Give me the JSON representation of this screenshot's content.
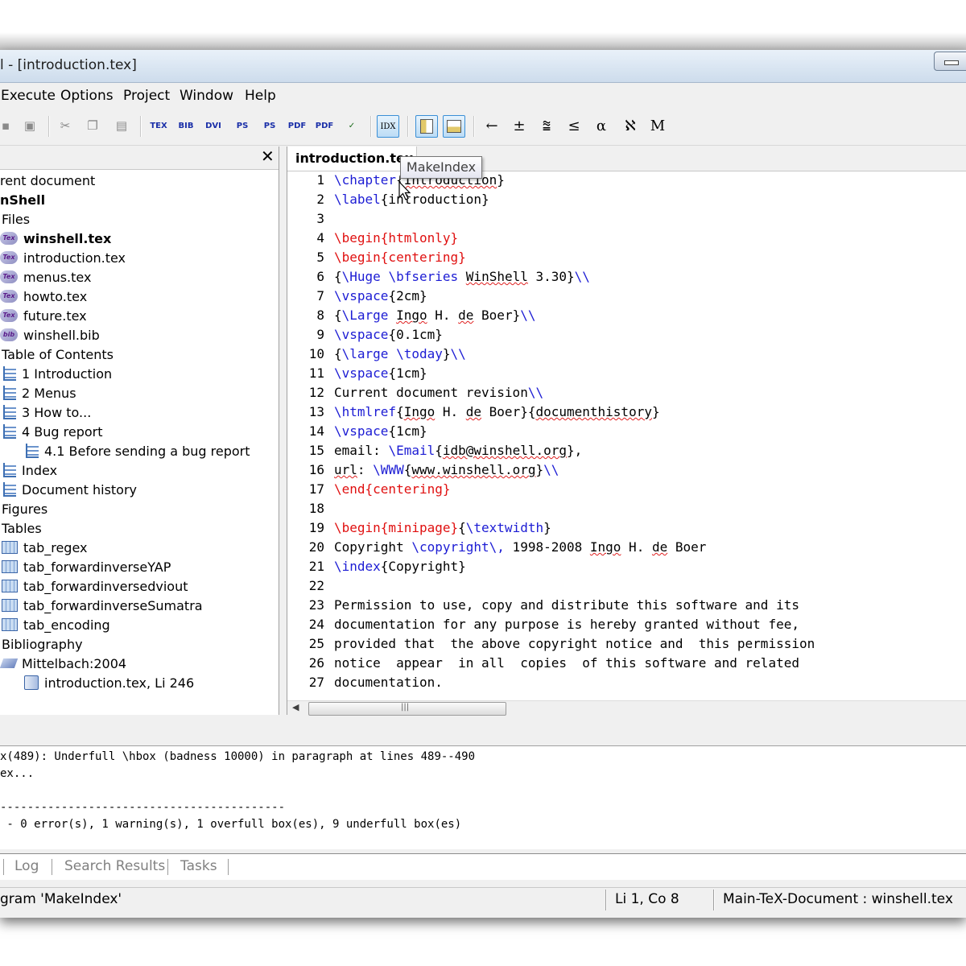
{
  "window": {
    "title": "l - [introduction.tex]"
  },
  "menu": [
    "Execute",
    "Options",
    "Project",
    "Window",
    "Help"
  ],
  "toolbar": {
    "tex": "TEX",
    "bib": "BIB",
    "dvi": "DVI",
    "ps": "PS",
    "pdf": "PDF",
    "idx": "IDX",
    "symbols": [
      "←",
      "±",
      "⩰",
      "≤",
      "α",
      "ℵ",
      "M"
    ]
  },
  "tooltip": "MakeIndex",
  "tree": {
    "current_document": "rent document",
    "project": "nShell",
    "files_label": "Files",
    "files": [
      "winshell.tex",
      "introduction.tex",
      "menus.tex",
      "howto.tex",
      "future.tex",
      "winshell.bib"
    ],
    "toc_label": "Table of Contents",
    "toc": [
      "1 Introduction",
      "2 Menus",
      "3 How to...",
      "4 Bug report",
      "4.1 Before sending a bug report",
      "Index",
      "Document history"
    ],
    "figures_label": "Figures",
    "tables_label": "Tables",
    "tables": [
      "tab_regex",
      "tab_forwardinverseYAP",
      "tab_forwardinversedviout",
      "tab_forwardinverseSumatra",
      "tab_encoding"
    ],
    "bibliography_label": "Bibliography",
    "bib_entry": "Mittelbach:2004",
    "bib_ref": "introduction.tex, Li 246"
  },
  "editor": {
    "tab": "introduction.tex",
    "lines": [
      "\\chapter{Introduction}",
      "\\label{introduction}",
      "",
      "\\begin{htmlonly}",
      "\\begin{centering}",
      "{\\Huge \\bfseries WinShell 3.30}\\\\",
      "\\vspace{2cm}",
      "{\\Large Ingo H. de Boer}\\\\",
      "\\vspace{0.1cm}",
      "{\\large \\today}\\\\",
      "\\vspace{1cm}",
      "Current document revision\\\\",
      "\\htmlref{Ingo H. de Boer}{documenthistory}",
      "\\vspace{1cm}",
      "email: \\Email{idb@winshell.org},",
      "url: \\WWW{www.winshell.org}\\\\",
      "\\end{centering}",
      "",
      "\\begin{minipage}{\\textwidth}",
      "Copyright \\copyright\\, 1998-2008 Ingo H. de Boer",
      "\\index{Copyright}",
      "",
      "Permission to use, copy and distribute this software and its",
      "documentation for any purpose is hereby granted without fee,",
      "provided that  the above copyright notice and  this permission",
      "notice  appear  in all  copies  of this software and related",
      "documentation."
    ]
  },
  "output": [
    "x(489): Underfull \\hbox (badness 10000) in paragraph at lines 489--490",
    "ex...",
    "",
    "------------------------------------------",
    " - 0 error(s), 1 warning(s), 1 overfull box(es), 9 underfull box(es)"
  ],
  "bottom_tabs": [
    "Log",
    "Search Results",
    "Tasks"
  ],
  "status": {
    "message": "gram 'MakeIndex'",
    "position": "Li 1, Co 8",
    "main_doc": "Main-TeX-Document : winshell.tex"
  }
}
